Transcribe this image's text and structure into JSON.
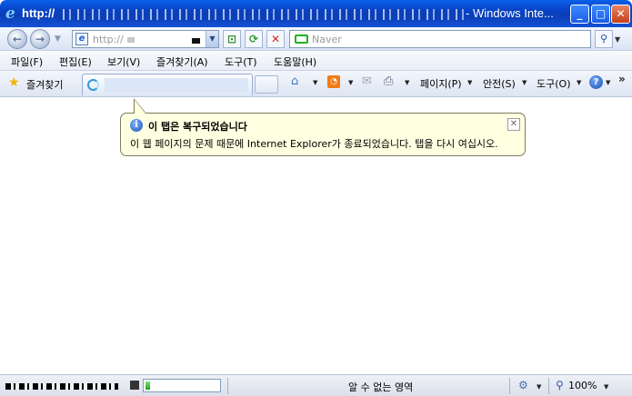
{
  "window": {
    "title_prefix": "http://",
    "title_suffix": "- Windows Inte...",
    "minimize_glyph": "_",
    "maximize_glyph": "□",
    "close_glyph": "✕"
  },
  "address_bar": {
    "url_prefix": "http://",
    "refresh_glyph": "⟳",
    "stop_glyph": "✕",
    "compat_glyph": "⊡"
  },
  "search": {
    "engine_placeholder": "Naver",
    "search_glyph": "⚲"
  },
  "menu": {
    "items": [
      {
        "label": "파일(F)"
      },
      {
        "label": "편집(E)"
      },
      {
        "label": "보기(V)"
      },
      {
        "label": "즐겨찾기(A)"
      },
      {
        "label": "도구(T)"
      },
      {
        "label": "도움말(H)"
      }
    ]
  },
  "command_bar": {
    "favorites_label": "즐겨찾기",
    "page_label": "페이지(P)",
    "safety_label": "안전(S)",
    "tools_label": "도구(O)",
    "help_glyph": "?",
    "more_glyph": "»"
  },
  "notification": {
    "title": "이 탭은 복구되었습니다",
    "message": "이 웹 페이지의 문제 때문에 Internet Explorer가 종료되었습니다. 탭을 다시 여십시오.",
    "info_glyph": "i",
    "close_glyph": "✕"
  },
  "status_bar": {
    "zone_text": "알 수 없는 영역",
    "zoom_text": "100%",
    "progress": 0.06
  },
  "colors": {
    "titlebar_blue": "#0842c4",
    "balloon_bg": "#ffffe1",
    "progress_green": "#22a11f",
    "feed_orange": "#f07b16"
  },
  "icons": [
    "ie-logo-icon",
    "back-icon",
    "forward-icon",
    "page-icon",
    "compat-view-icon",
    "refresh-icon",
    "stop-icon",
    "naver-icon",
    "search-icon",
    "favorites-star-icon",
    "loading-icon",
    "home-icon",
    "feed-icon",
    "mail-icon",
    "print-icon",
    "help-icon",
    "info-icon",
    "security-icon",
    "zoom-icon"
  ]
}
